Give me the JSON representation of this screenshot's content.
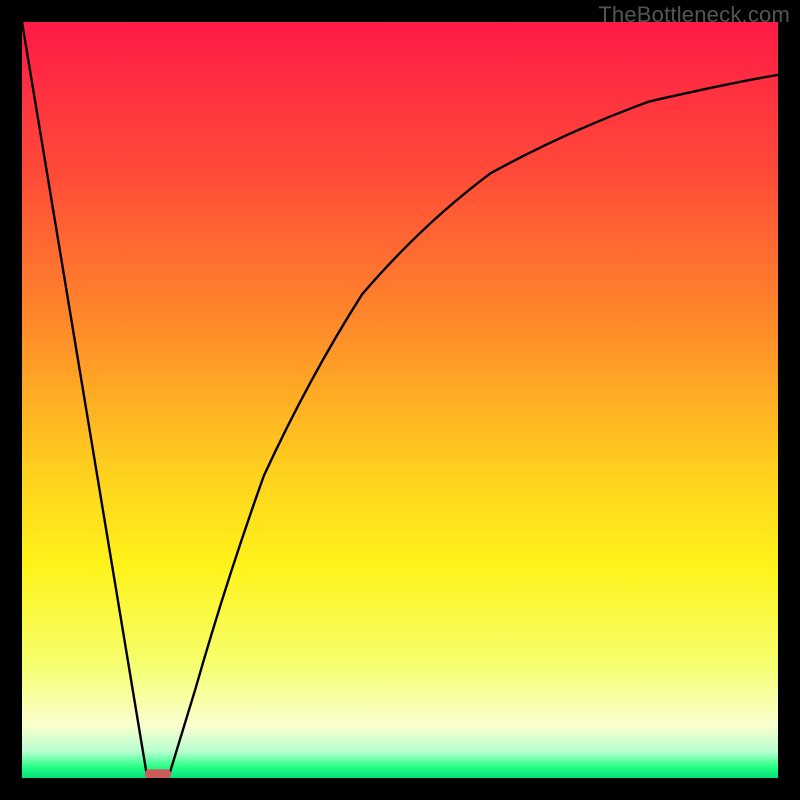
{
  "watermark": "TheBottleneck.com",
  "chart_data": {
    "type": "line",
    "title": "",
    "xlabel": "",
    "ylabel": "",
    "xlim": [
      0,
      1
    ],
    "ylim": [
      0,
      1
    ],
    "grid": false,
    "legend": false,
    "gradient_stops": [
      {
        "pos": 0.0,
        "color": "#ff1a47"
      },
      {
        "pos": 0.2,
        "color": "#ff4b38"
      },
      {
        "pos": 0.4,
        "color": "#ff8a2a"
      },
      {
        "pos": 0.6,
        "color": "#ffd21e"
      },
      {
        "pos": 0.72,
        "color": "#fff31a"
      },
      {
        "pos": 0.85,
        "color": "#f6ff6e"
      },
      {
        "pos": 0.93,
        "color": "#faffcf"
      },
      {
        "pos": 0.965,
        "color": "#b8ffd0"
      },
      {
        "pos": 0.985,
        "color": "#2aff88"
      },
      {
        "pos": 1.0,
        "color": "#00e076"
      }
    ],
    "series": [
      {
        "name": "left-descent",
        "x": [
          0.0,
          0.165
        ],
        "y": [
          1.0,
          0.005
        ]
      },
      {
        "name": "right-ascent",
        "x": [
          0.195,
          0.23,
          0.27,
          0.32,
          0.38,
          0.45,
          0.53,
          0.62,
          0.72,
          0.83,
          0.94,
          1.0
        ],
        "y": [
          0.005,
          0.12,
          0.26,
          0.4,
          0.53,
          0.64,
          0.73,
          0.8,
          0.855,
          0.895,
          0.92,
          0.93
        ]
      }
    ],
    "minimum_marker": {
      "name": "bottom-pill",
      "x_center": 0.18,
      "y": 0.003,
      "width": 0.035,
      "height": 0.012,
      "color": "#cc5a5a"
    }
  }
}
